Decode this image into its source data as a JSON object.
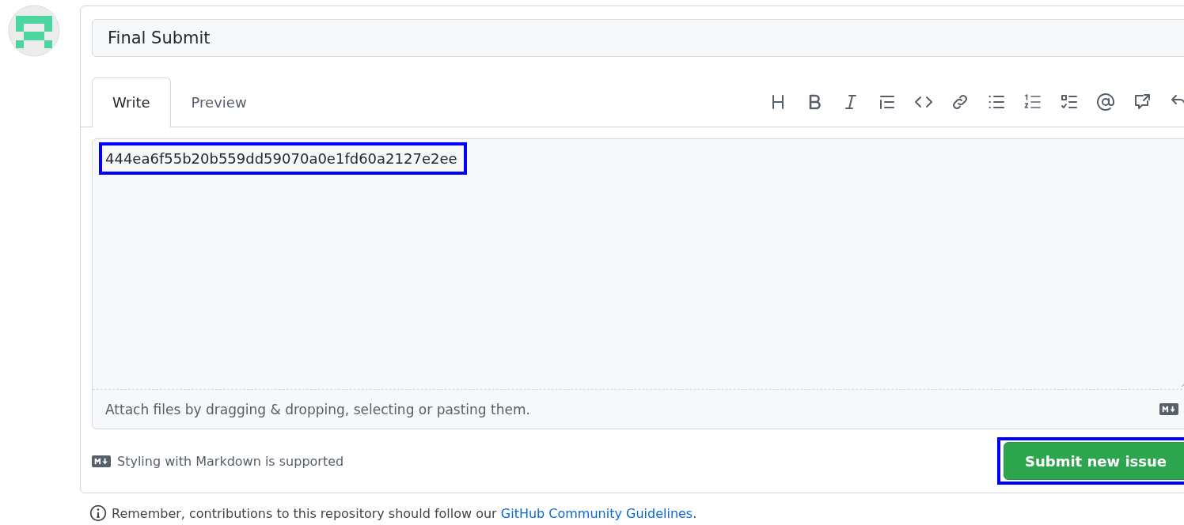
{
  "issue_title": {
    "value": "Final Submit"
  },
  "tabs": [
    {
      "label": "Write",
      "selected": true
    },
    {
      "label": "Preview",
      "selected": false
    }
  ],
  "toolbar": [
    {
      "kind": "heading"
    },
    {
      "kind": "bold"
    },
    {
      "kind": "italic"
    },
    {
      "kind": "quote"
    },
    {
      "kind": "code"
    },
    {
      "kind": "link"
    },
    {
      "kind": "bullets"
    },
    {
      "kind": "numbered"
    },
    {
      "kind": "tasks"
    },
    {
      "kind": "mention"
    },
    {
      "kind": "reference"
    },
    {
      "kind": "undo"
    }
  ],
  "body": {
    "value": "444ea6f55b20b559dd59070a0e1fd60a2127e2ee",
    "highlighted": true
  },
  "attach_hint": "Attach files by dragging & dropping, selecting or pasting them.",
  "markdown_note": "Styling with Markdown is supported",
  "submit_button": {
    "label": "Submit new issue",
    "highlighted": true
  },
  "guidelines_note": {
    "text": "Remember, contributions to this repository should follow our",
    "link": "GitHub Community Guidelines",
    "end": "."
  }
}
